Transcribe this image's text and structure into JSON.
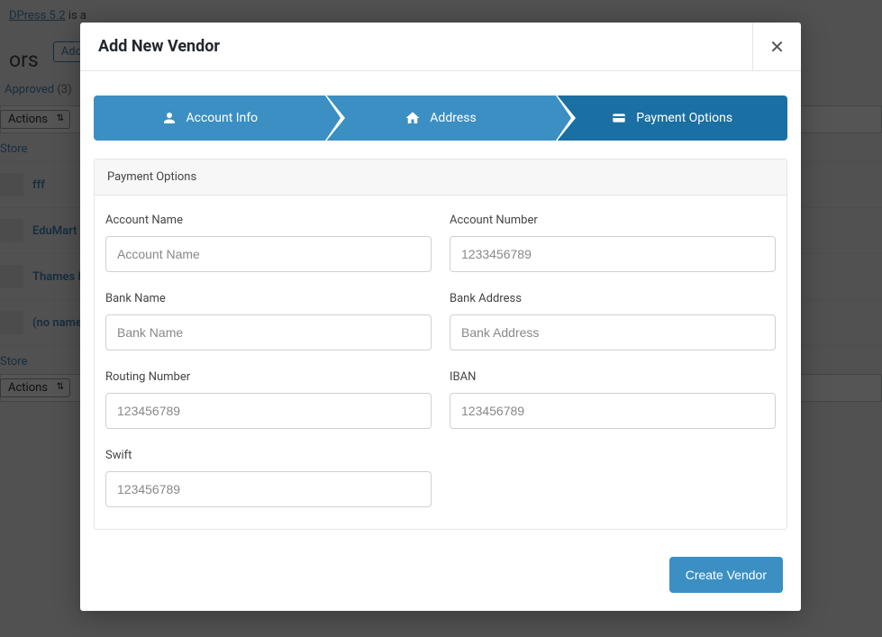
{
  "background": {
    "notice_link": "DPress 5.2",
    "notice_text": " is a",
    "heading_fragment": "ors",
    "add_new": "Add N",
    "filter_tab": "Approved",
    "filter_count": "(3)",
    "bulk": "Actions",
    "store_header": "Store",
    "rows": [
      "fff",
      "EduMart",
      "Thames I",
      "(no name"
    ]
  },
  "modal": {
    "title": "Add New Vendor",
    "steps": {
      "account": "Account Info",
      "address": "Address",
      "payment": "Payment Options"
    },
    "panel_title": "Payment Options",
    "fields": {
      "account_name": {
        "label": "Account Name",
        "placeholder": "Account Name"
      },
      "account_number": {
        "label": "Account Number",
        "placeholder": "1233456789"
      },
      "bank_name": {
        "label": "Bank Name",
        "placeholder": "Bank Name"
      },
      "bank_address": {
        "label": "Bank Address",
        "placeholder": "Bank Address"
      },
      "routing_number": {
        "label": "Routing Number",
        "placeholder": "123456789"
      },
      "iban": {
        "label": "IBAN",
        "placeholder": "123456789"
      },
      "swift": {
        "label": "Swift",
        "placeholder": "123456789"
      }
    },
    "submit": "Create Vendor"
  }
}
